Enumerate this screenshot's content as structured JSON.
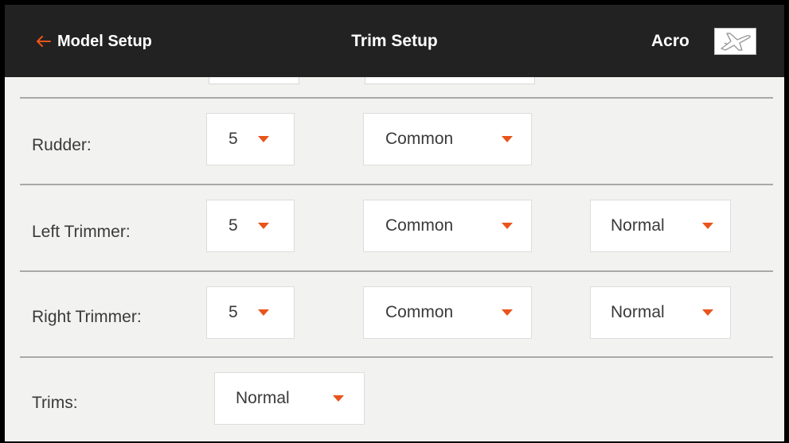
{
  "header": {
    "back_label": "Model Setup",
    "title": "Trim Setup",
    "model_name": "Acro",
    "model_icon": "airplane-icon",
    "back_icon": "arrow-left-icon",
    "accent_color": "#e8541b",
    "bar_color": "#222222"
  },
  "rows": [
    {
      "label": "Rudder:",
      "step": "5",
      "mode": "Common"
    },
    {
      "label": "Left Trimmer:",
      "step": "5",
      "mode": "Common",
      "direction": "Normal"
    },
    {
      "label": "Right Trimmer:",
      "step": "5",
      "mode": "Common",
      "direction": "Normal"
    },
    {
      "label": "Trims:",
      "type": "Normal"
    }
  ]
}
